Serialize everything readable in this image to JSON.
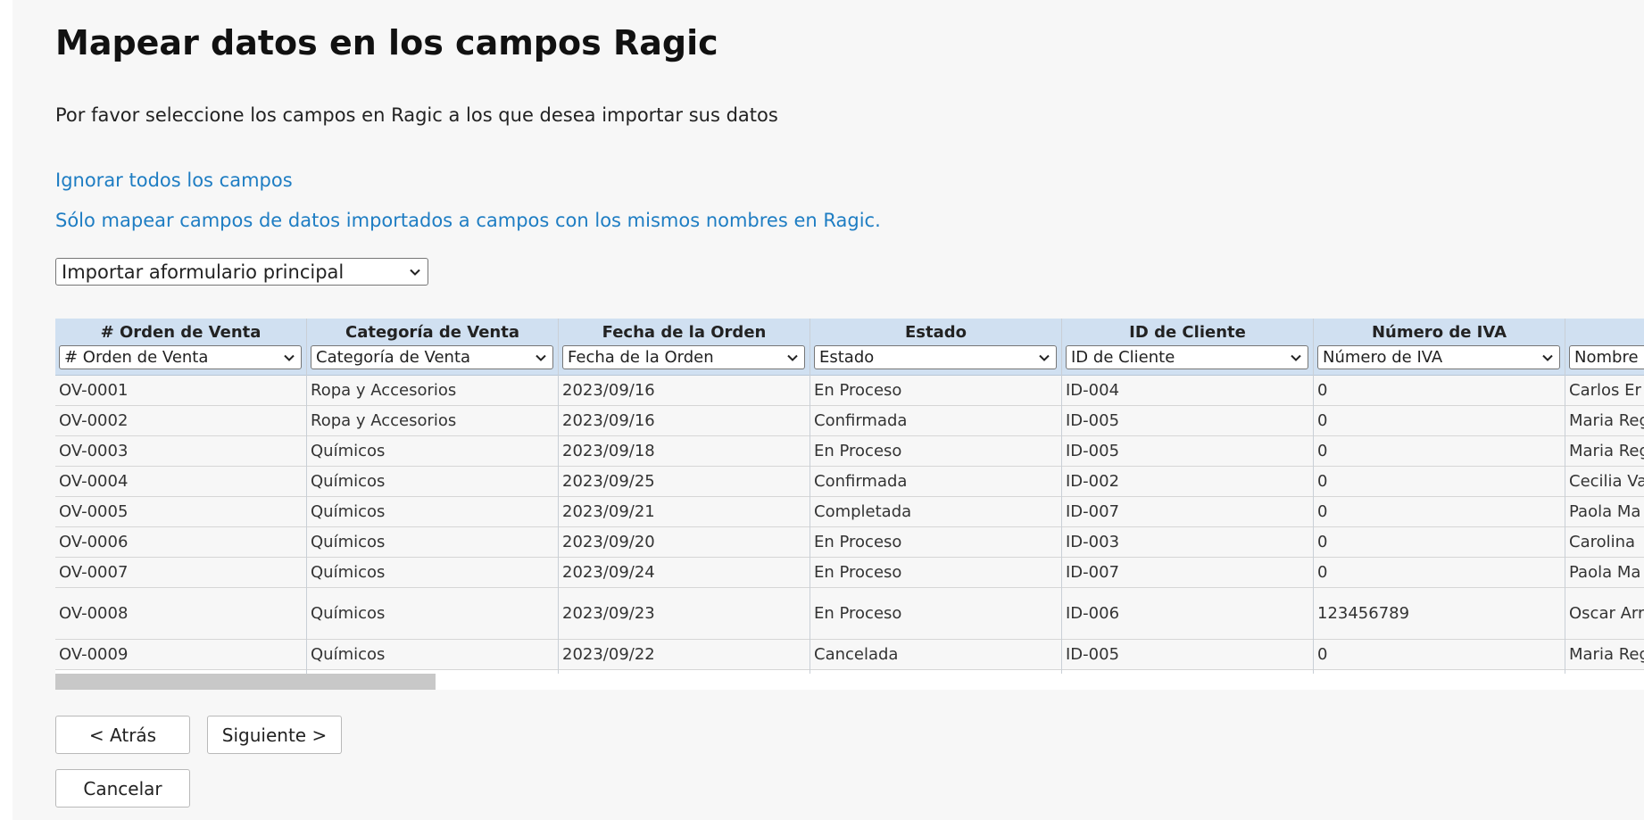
{
  "page": {
    "title": "Mapear datos en los campos Ragic",
    "subtitle": "Por favor seleccione los campos en Ragic a los que desea importar sus datos"
  },
  "links": {
    "ignore_all": "Ignorar todos los campos",
    "map_same_names": "Sólo mapear campos de datos importados a campos con los mismos nombres en Ragic."
  },
  "import_target": {
    "selected": "Importar aformulario principal"
  },
  "table": {
    "columns": [
      {
        "header": "# Orden de Venta",
        "mapped": "# Orden de Venta"
      },
      {
        "header": "Categoría de Venta",
        "mapped": "Categoría de Venta"
      },
      {
        "header": "Fecha de la Orden",
        "mapped": "Fecha de la Orden"
      },
      {
        "header": "Estado",
        "mapped": "Estado"
      },
      {
        "header": "ID de Cliente",
        "mapped": "ID de Cliente"
      },
      {
        "header": "Número de IVA",
        "mapped": "Número de IVA"
      },
      {
        "header": "",
        "mapped": "Nombre"
      }
    ],
    "rows": [
      [
        "OV-0001",
        "Ropa y Accesorios",
        "2023/09/16",
        "En Proceso",
        "ID-004",
        "0",
        "Carlos Er"
      ],
      [
        "OV-0002",
        "Ropa y Accesorios",
        "2023/09/16",
        "Confirmada",
        "ID-005",
        "0",
        "Maria Reg"
      ],
      [
        "OV-0003",
        "Químicos",
        "2023/09/18",
        "En Proceso",
        "ID-005",
        "0",
        "Maria Reg"
      ],
      [
        "OV-0004",
        "Químicos",
        "2023/09/25",
        "Confirmada",
        "ID-002",
        "0",
        "Cecilia Va"
      ],
      [
        "OV-0005",
        "Químicos",
        "2023/09/21",
        "Completada",
        "ID-007",
        "0",
        "Paola Ma"
      ],
      [
        "OV-0006",
        "Químicos",
        "2023/09/20",
        "En Proceso",
        "ID-003",
        "0",
        "Carolina"
      ],
      [
        "OV-0007",
        "Químicos",
        "2023/09/24",
        "En Proceso",
        "ID-007",
        "0",
        "Paola Ma"
      ],
      [
        "OV-0008",
        "Químicos",
        "2023/09/23",
        "En Proceso",
        "ID-006",
        "123456789",
        "Oscar Arr"
      ],
      [
        "OV-0009",
        "Químicos",
        "2023/09/22",
        "Cancelada",
        "ID-005",
        "0",
        "Maria Reg"
      ]
    ]
  },
  "buttons": {
    "back": "< Atrás",
    "next": "Siguiente >",
    "cancel": "Cancelar"
  }
}
